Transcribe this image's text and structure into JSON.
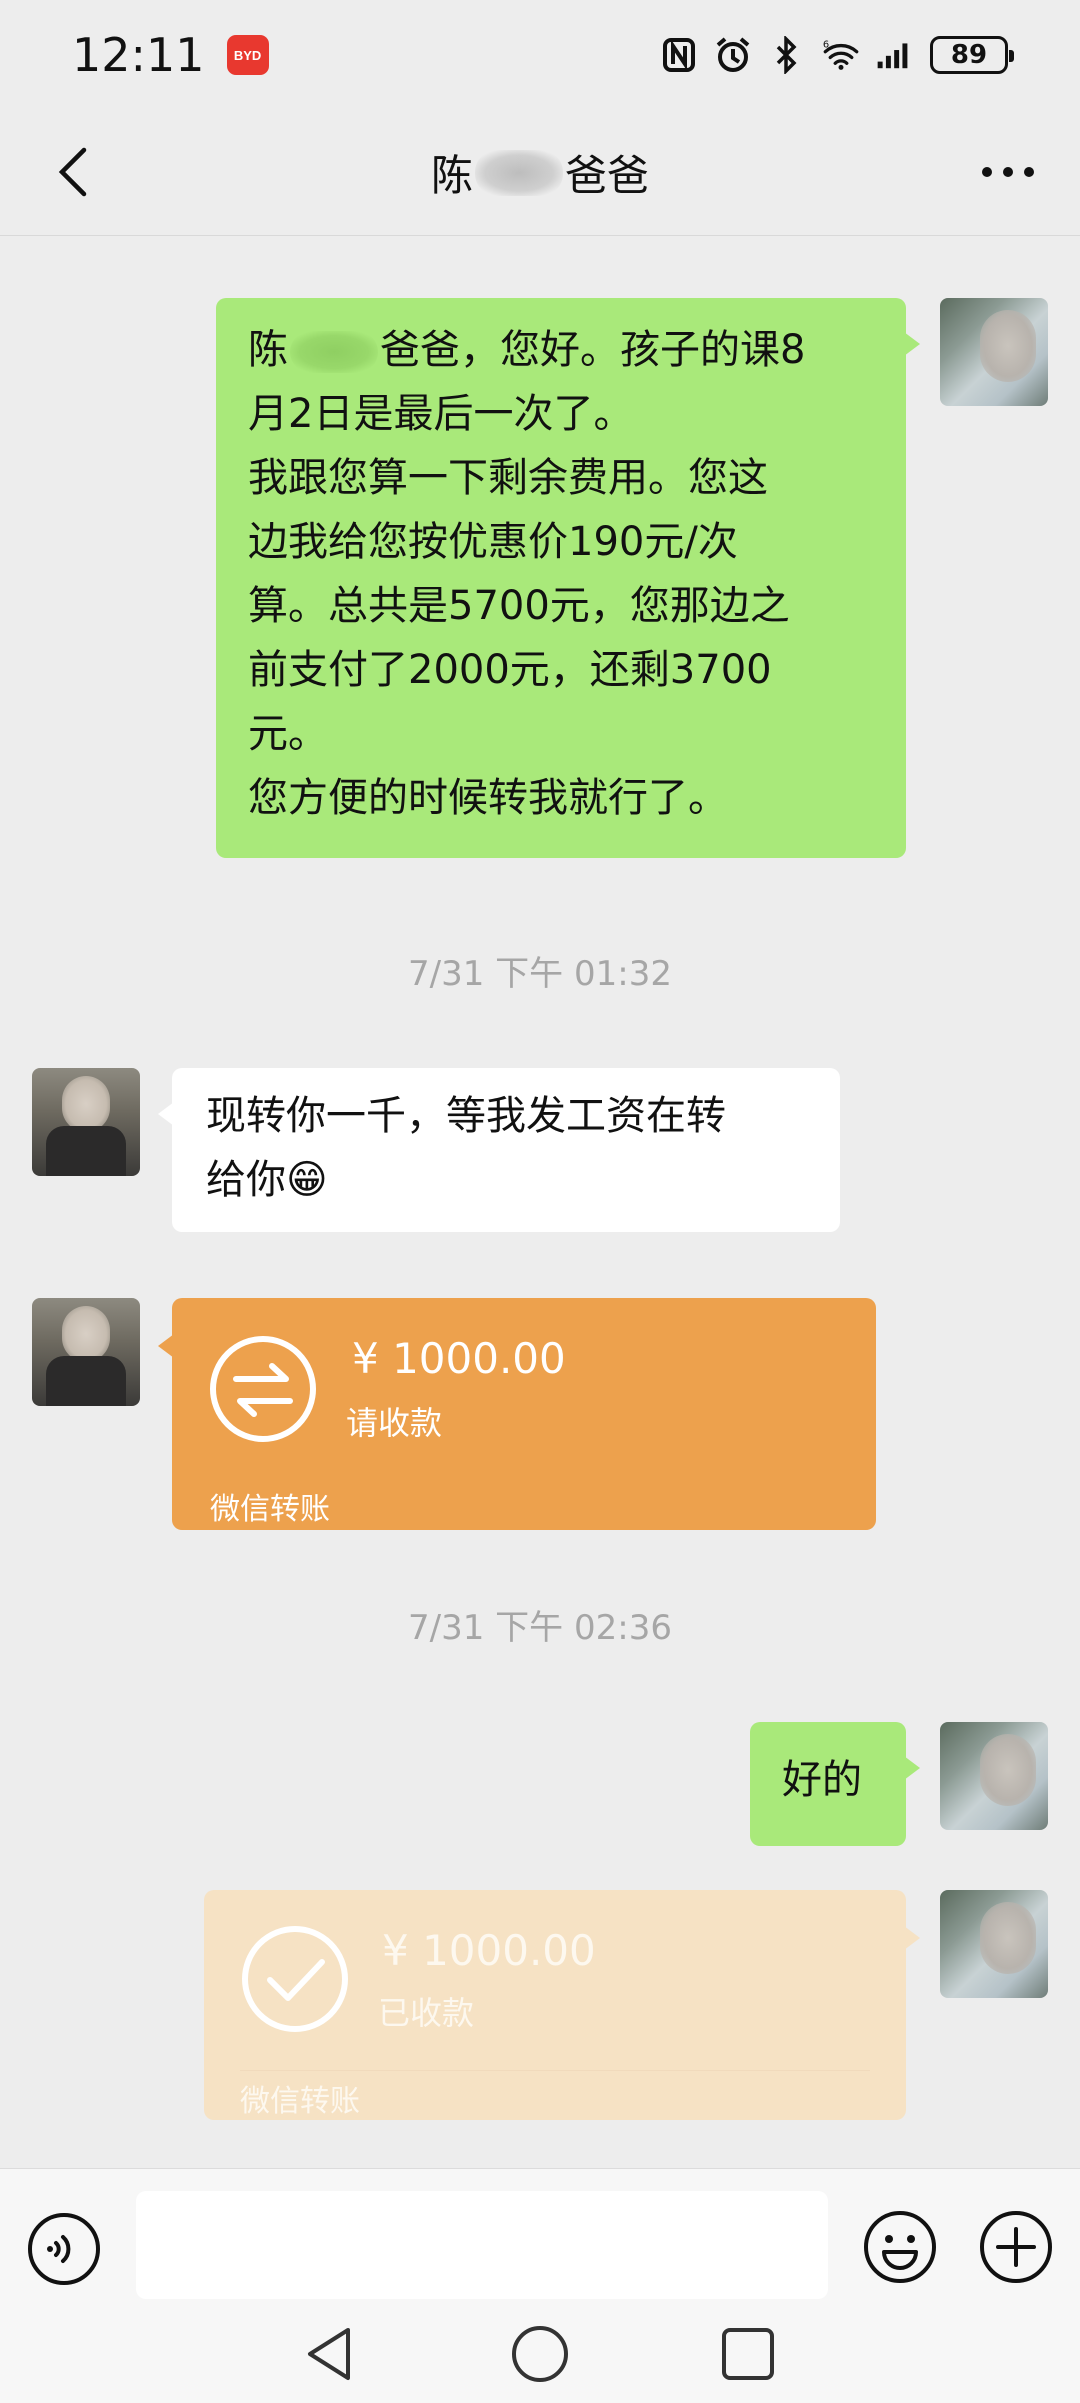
{
  "status_bar": {
    "time": "12:11",
    "brand_badge": "BYD",
    "battery": "89",
    "icons": [
      "nfc-icon",
      "alarm-icon",
      "bluetooth-icon",
      "wifi-6-icon",
      "signal-icon",
      "battery-icon"
    ]
  },
  "header": {
    "title_prefix": "陈",
    "title_suffix": "爸爸"
  },
  "messages": {
    "m1": {
      "lines": [
        "爸爸，您好。孩子的课8",
        "月2日是最后一次了。",
        "我跟您算一下剩余费用。您这",
        "边我给您按优惠价190元/次",
        "算。总共是5700元，您那边之",
        "前支付了2000元，还剩3700",
        "元。",
        "您方便的时候转我就行了。"
      ],
      "line1_prefix": "陈"
    },
    "ts1": "7/31 下午 01:32",
    "m2": {
      "lines": [
        "现转你一千，等我发工资在转",
        "给你😁"
      ]
    },
    "transfer_in": {
      "amount": "¥ 1000.00",
      "status": "请收款",
      "footer": "微信转账"
    },
    "ts2": "7/31 下午 02:36",
    "m3": {
      "text": "好的"
    },
    "transfer_out": {
      "amount": "¥ 1000.00",
      "status": "已收款",
      "footer": "微信转账"
    }
  },
  "input_bar": {
    "value": ""
  },
  "colors": {
    "background": "#ededed",
    "outgoing_bubble": "#a9e97a",
    "incoming_bubble": "#ffffff",
    "transfer_pending": "#eda14d",
    "transfer_received": "#f6e2c4"
  }
}
